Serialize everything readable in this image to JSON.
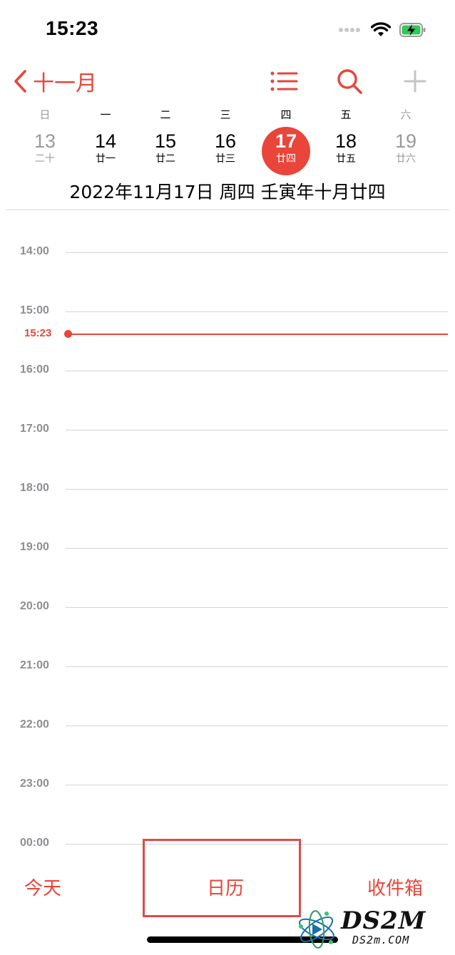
{
  "status_bar": {
    "time": "15:23"
  },
  "nav": {
    "back_label": "十一月"
  },
  "weekdays": [
    "日",
    "一",
    "二",
    "三",
    "四",
    "五",
    "六"
  ],
  "week_dates": [
    {
      "day": "13",
      "lunar": "二十"
    },
    {
      "day": "14",
      "lunar": "廿一"
    },
    {
      "day": "15",
      "lunar": "廿二"
    },
    {
      "day": "16",
      "lunar": "廿三"
    },
    {
      "day": "17",
      "lunar": "廿四"
    },
    {
      "day": "18",
      "lunar": "廿五"
    },
    {
      "day": "19",
      "lunar": "廿六"
    }
  ],
  "date_header": "2022年11月17日 周四   壬寅年十月廿四",
  "timeline": {
    "hours": [
      "14:00",
      "15:00",
      "16:00",
      "17:00",
      "18:00",
      "19:00",
      "20:00",
      "21:00",
      "22:00",
      "23:00",
      "00:00"
    ],
    "now_label": "15:23"
  },
  "tab_bar": {
    "today": "今天",
    "calendars": "日历",
    "inbox": "收件箱"
  },
  "watermark": {
    "logo": "DS2M",
    "site": "DS2m.COM"
  },
  "colors": {
    "accent": "#e9453a",
    "muted_text": "#9a9a9a",
    "grid_line": "#d4d4d4"
  }
}
